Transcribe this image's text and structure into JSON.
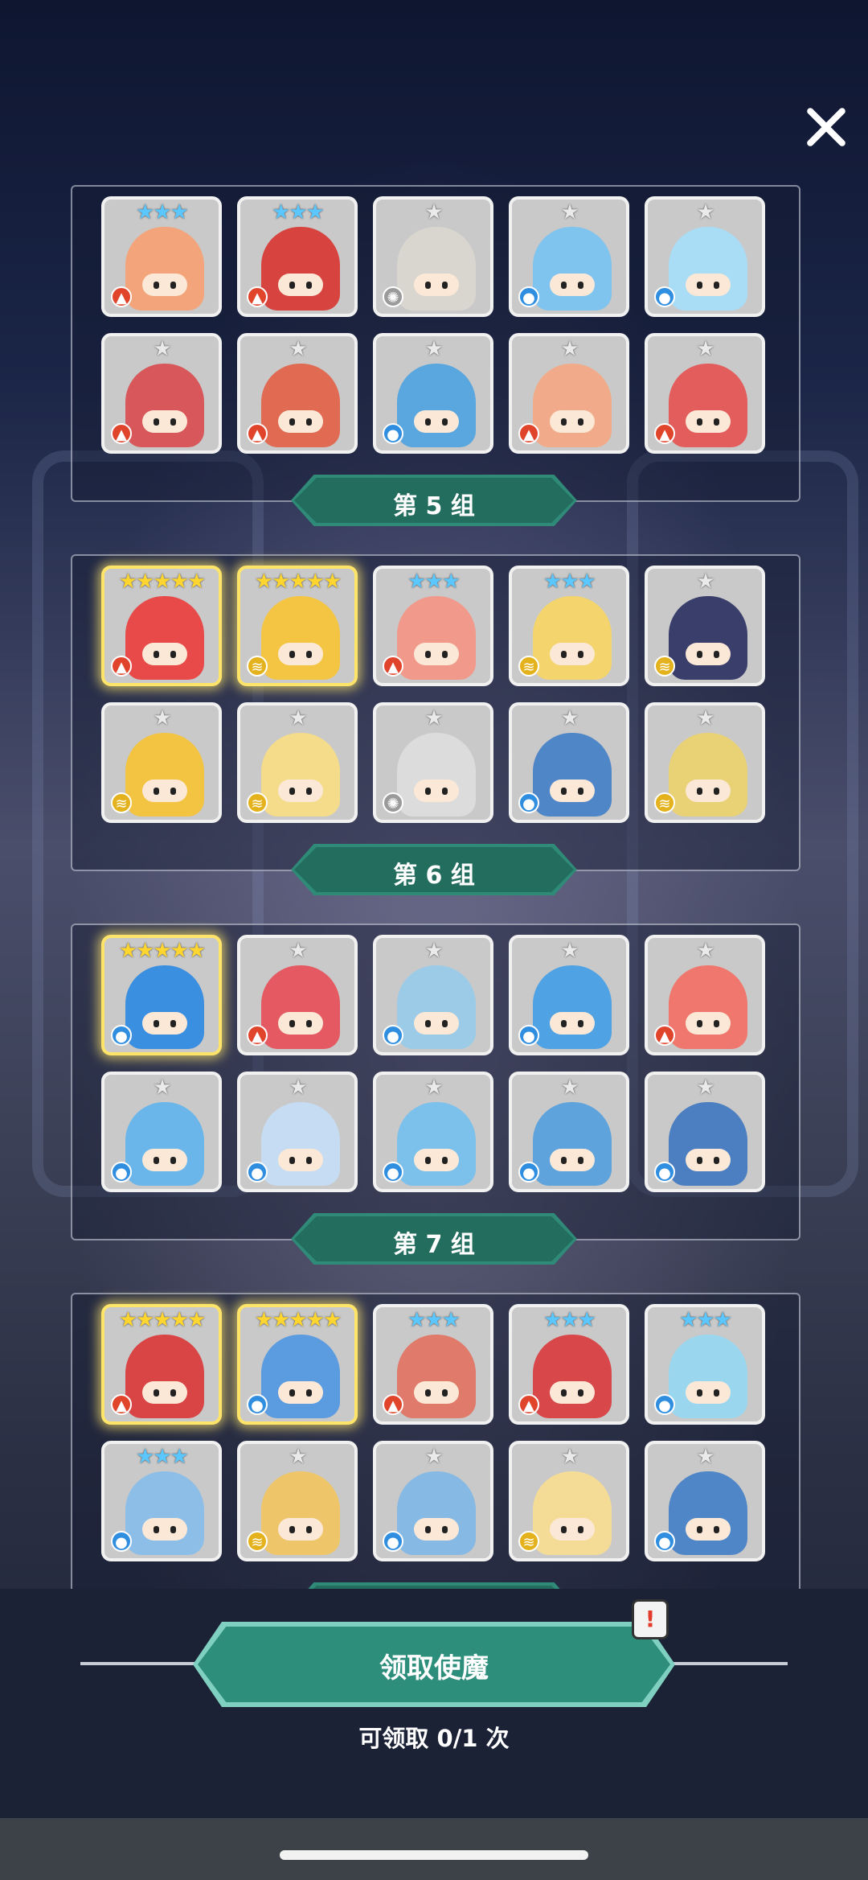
{
  "colors": {
    "panel_border": "#dfe2ef",
    "label_green": "#236d5e",
    "button_green": "#2e8e7c",
    "star_gold": "#ffd630",
    "star_blue": "#5cc7ff",
    "star_silver": "#eaeaea"
  },
  "icons": {
    "close": "close-icon",
    "alert": "exclamation-icon"
  },
  "groups": [
    {
      "label": "第 5 组",
      "cards": [
        {
          "stars": "★★★",
          "elem": "fire",
          "color": "#f3a47a"
        },
        {
          "stars": "★★★",
          "elem": "fire",
          "color": "#d7433f"
        },
        {
          "stars": "★",
          "elem": "light",
          "color": "#d9d6cf"
        },
        {
          "stars": "★",
          "elem": "water",
          "color": "#7fc3ef"
        },
        {
          "stars": "★",
          "elem": "water",
          "color": "#a9dcf5"
        },
        {
          "stars": "★",
          "elem": "fire",
          "color": "#d8575a"
        },
        {
          "stars": "★",
          "elem": "fire",
          "color": "#e06a52"
        },
        {
          "stars": "★",
          "elem": "water",
          "color": "#5aa7df"
        },
        {
          "stars": "★",
          "elem": "fire",
          "color": "#f2ab8a"
        },
        {
          "stars": "★",
          "elem": "fire",
          "color": "#e35d5d"
        }
      ]
    },
    {
      "label": "第 6 组",
      "cards": [
        {
          "stars": "★★★★★",
          "elem": "fire",
          "color": "#e84a4a",
          "legend": true
        },
        {
          "stars": "★★★★★",
          "elem": "wind",
          "color": "#f4c542",
          "legend": true
        },
        {
          "stars": "★★★",
          "elem": "fire",
          "color": "#f19a8c"
        },
        {
          "stars": "★★★",
          "elem": "wind",
          "color": "#f3d46d"
        },
        {
          "stars": "★",
          "elem": "wind",
          "color": "#3a3e6b"
        },
        {
          "stars": "★",
          "elem": "wind",
          "color": "#f2c441"
        },
        {
          "stars": "★",
          "elem": "wind",
          "color": "#f5dc8a"
        },
        {
          "stars": "★",
          "elem": "light",
          "color": "#dcdcdc"
        },
        {
          "stars": "★",
          "elem": "water",
          "color": "#4f86c8"
        },
        {
          "stars": "★",
          "elem": "wind",
          "color": "#e9d175"
        }
      ]
    },
    {
      "label": "第 7 组",
      "cards": [
        {
          "stars": "★★★★★",
          "elem": "water",
          "color": "#3b8fe0",
          "legend": true
        },
        {
          "stars": "★",
          "elem": "fire",
          "color": "#e55a62"
        },
        {
          "stars": "★",
          "elem": "water",
          "color": "#9ccbe8"
        },
        {
          "stars": "★",
          "elem": "water",
          "color": "#4fa2e4"
        },
        {
          "stars": "★",
          "elem": "fire",
          "color": "#f0776e"
        },
        {
          "stars": "★",
          "elem": "water",
          "color": "#6ab6ea"
        },
        {
          "stars": "★",
          "elem": "water",
          "color": "#c6dcf2"
        },
        {
          "stars": "★",
          "elem": "water",
          "color": "#7cc0ec"
        },
        {
          "stars": "★",
          "elem": "water",
          "color": "#5ea3dc"
        },
        {
          "stars": "★",
          "elem": "water",
          "color": "#4b7fc1"
        }
      ]
    },
    {
      "label": "",
      "cards": [
        {
          "stars": "★★★★★",
          "elem": "fire",
          "color": "#d94444",
          "legend": true
        },
        {
          "stars": "★★★★★",
          "elem": "water",
          "color": "#5b9be0",
          "legend": true
        },
        {
          "stars": "★★★",
          "elem": "fire",
          "color": "#e07a6a"
        },
        {
          "stars": "★★★",
          "elem": "fire",
          "color": "#d8474a"
        },
        {
          "stars": "★★★",
          "elem": "water",
          "color": "#9ad6ee"
        },
        {
          "stars": "★★★",
          "elem": "water",
          "color": "#8cbee8"
        },
        {
          "stars": "★",
          "elem": "wind",
          "color": "#efc56a"
        },
        {
          "stars": "★",
          "elem": "water",
          "color": "#86b9e4"
        },
        {
          "stars": "★",
          "elem": "wind",
          "color": "#f5dc96"
        },
        {
          "stars": "★",
          "elem": "water",
          "color": "#4f86c8"
        }
      ]
    }
  ],
  "claim_button": {
    "label": "领取使魔"
  },
  "alert_badge": "!",
  "claim_count": "可领取 0/1 次"
}
